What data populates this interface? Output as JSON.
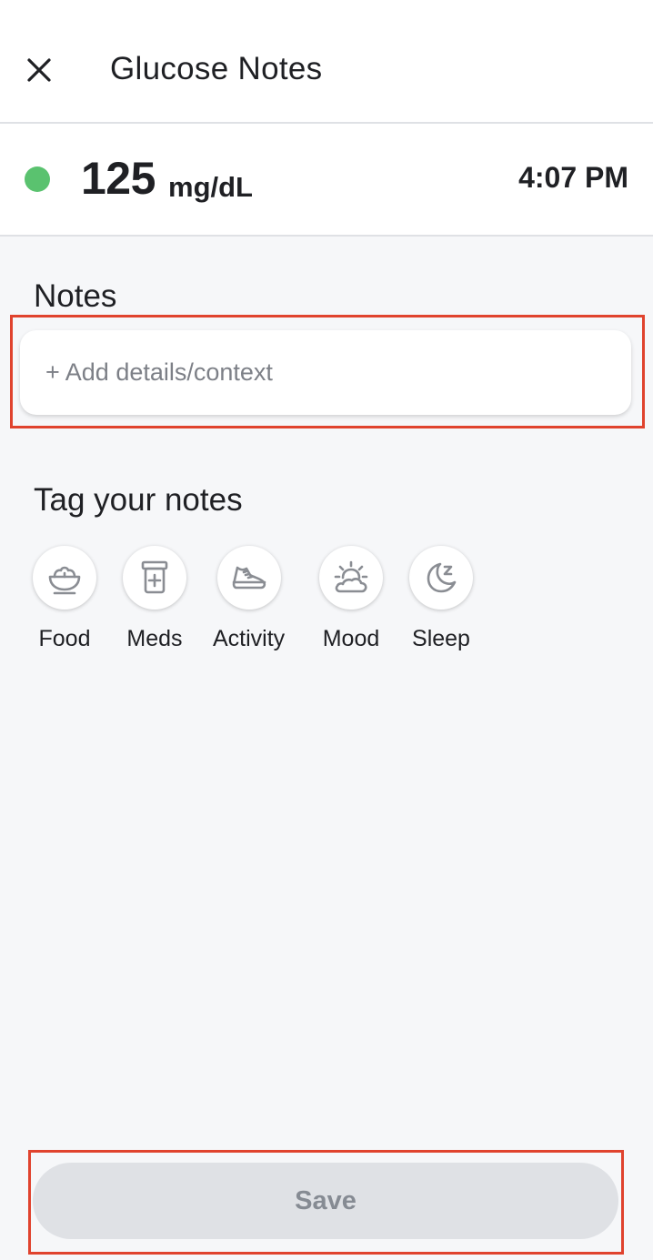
{
  "header": {
    "title": "Glucose Notes",
    "close_icon": "close-icon"
  },
  "reading": {
    "value": "125",
    "unit": "mg/dL",
    "time": "4:07 PM",
    "status_color": "#5ac26f"
  },
  "notes": {
    "label": "Notes",
    "placeholder": "+ Add details/context"
  },
  "tags": {
    "label": "Tag your notes",
    "items": [
      {
        "label": "Food",
        "icon": "food-bowl-icon"
      },
      {
        "label": "Meds",
        "icon": "pill-bottle-icon"
      },
      {
        "label": "Activity",
        "icon": "sneaker-icon"
      },
      {
        "label": "Mood",
        "icon": "sun-cloud-icon"
      },
      {
        "label": "Sleep",
        "icon": "moon-sleep-icon"
      }
    ]
  },
  "save": {
    "label": "Save"
  },
  "colors": {
    "highlight": "#e0432e",
    "icon_gray": "#8a8d93",
    "button_disabled_bg": "#dfe1e5"
  }
}
